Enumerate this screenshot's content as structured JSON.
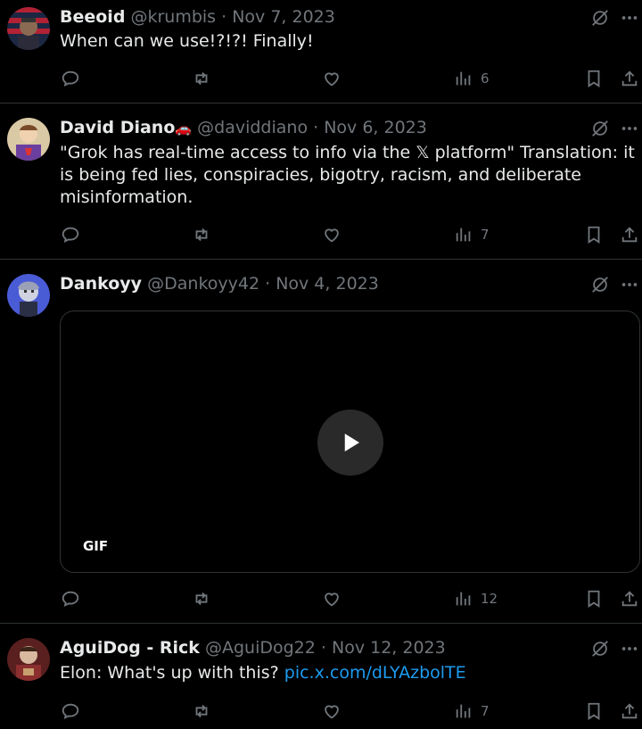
{
  "tweets": [
    {
      "name": "Beeoid",
      "handle": "@krumbis",
      "date": "Nov 7, 2023",
      "text": "When can we use!?!?! Finally!",
      "views": "6",
      "avatar_colors": [
        "#3a4d7a",
        "#b22234"
      ]
    },
    {
      "name": "David Diano",
      "handle": "@daviddiano",
      "date": "Nov 6, 2023",
      "name_emoji": "🚗",
      "text": "\"Grok has real-time access to info via the 𝕏 platform\"  Translation: it is being fed lies, conspiracies, bigotry, racism, and deliberate misinformation.",
      "views": "7",
      "avatar_colors": [
        "#c9b27a",
        "#6b3fa0"
      ]
    },
    {
      "name": "Dankoyy",
      "handle": "@Dankoyy42",
      "date": "Nov 4, 2023",
      "media_label": "GIF",
      "views": "12",
      "avatar_colors": [
        "#4a5bd6",
        "#cfd3e0"
      ]
    },
    {
      "name": "AguiDog - Rick",
      "handle": "@AguiDog22",
      "date": "Nov 12, 2023",
      "text": "Elon: What's up with this? ",
      "link": "pic.x.com/dLYAzbolTE",
      "views": "7",
      "avatar_colors": [
        "#7a2a2a",
        "#d9b8a0"
      ]
    }
  ],
  "sep": " · ",
  "colors": {
    "bg": "#000000",
    "text": "#e7e9ea",
    "muted": "#71767b",
    "link": "#1d9bf0",
    "border": "#2f3336"
  }
}
